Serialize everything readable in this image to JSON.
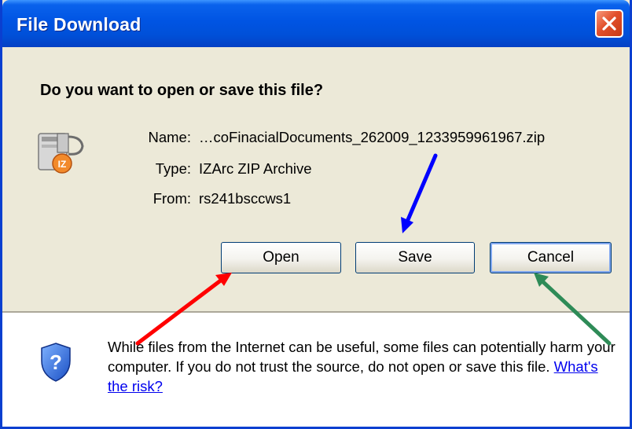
{
  "window": {
    "title": "File Download",
    "close_icon": "close-icon"
  },
  "prompt": {
    "question": "Do you want to open or save this file?"
  },
  "file": {
    "icon": "zip-archive-icon",
    "name_label": "Name:",
    "name_value": "…coFinacialDocuments_262009_1233959961967.zip",
    "type_label": "Type:",
    "type_value": "IZArc ZIP Archive",
    "from_label": "From:",
    "from_value": "rs241bsccws1"
  },
  "buttons": {
    "open_label": "Open",
    "save_label": "Save",
    "cancel_label": "Cancel"
  },
  "warning": {
    "icon": "shield-question-icon",
    "text": "While files from the Internet can be useful, some files can potentially harm your computer. If you do not trust the source, do not open or save this file.",
    "link_text": "What's the risk?"
  },
  "annotations": {
    "colors": {
      "open_arrow": "#ff0000",
      "save_arrow": "#0000ff",
      "cancel_arrow": "#2e8b57"
    }
  }
}
